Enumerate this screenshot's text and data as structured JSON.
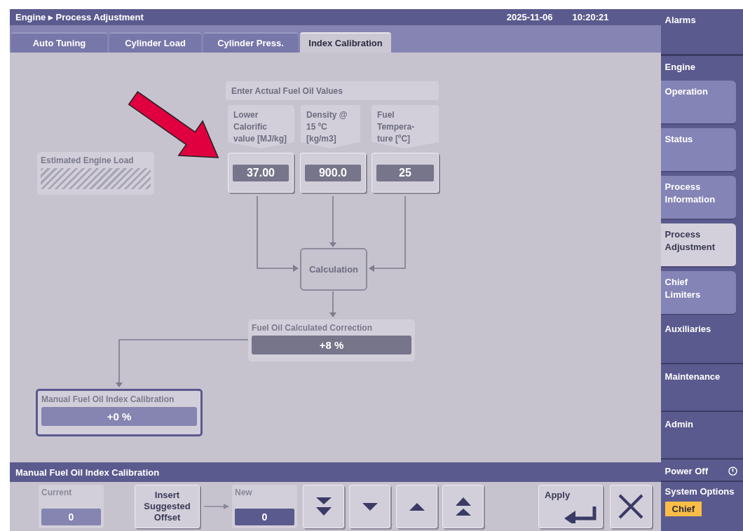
{
  "header": {
    "breadcrumb": "Engine ▸ Process Adjustment",
    "date": "2025-11-06",
    "time": "10:20:21"
  },
  "tabs": [
    {
      "label": "Auto Tuning",
      "selected": false
    },
    {
      "label": "Cylinder Load",
      "selected": false
    },
    {
      "label": "Cylinder Press.",
      "selected": false
    },
    {
      "label": "Index Calibration",
      "selected": true
    }
  ],
  "diagram": {
    "title": "Enter Actual Fuel Oil Values",
    "inputs": [
      {
        "label": "Lower Calorific\nvalue [MJ/kg]",
        "value": "37.00"
      },
      {
        "label": "Density @\n15 ºC [kg/m3]",
        "value": "900.0"
      },
      {
        "label": "Fuel Tempera-\nture [ºC]",
        "value": "25"
      }
    ],
    "estimated_load": {
      "label": "Estimated Engine Load"
    },
    "calculation": "Calculation",
    "correction": {
      "label": "Fuel Oil Calculated Correction",
      "value": "+8 %"
    },
    "manual": {
      "label": "Manual Fuel Oil Index Calibration",
      "value": "+0 %"
    }
  },
  "panel": {
    "title": "Manual Fuel Oil Index Calibration",
    "current": {
      "label": "Current",
      "value": "0"
    },
    "insert_button": "Insert\nSuggested\nOffset",
    "new": {
      "label": "New",
      "value": "0"
    },
    "steps": [
      {
        "kind": "fast-down"
      },
      {
        "kind": "down"
      },
      {
        "kind": "up"
      },
      {
        "kind": "fast-up"
      }
    ],
    "apply": "Apply"
  },
  "sidebar": {
    "alarms": "Alarms",
    "group": "Engine",
    "items": [
      {
        "label": "Operation",
        "kind": "sub",
        "selected": false
      },
      {
        "label": "Status",
        "kind": "sub",
        "selected": false
      },
      {
        "label": "Process\nInformation",
        "kind": "sub",
        "selected": false
      },
      {
        "label": "Process\nAdjustment",
        "kind": "sub",
        "selected": true
      },
      {
        "label": "Chief\nLimiters",
        "kind": "sub",
        "selected": false
      },
      {
        "label": "Auxiliaries",
        "kind": "section",
        "selected": false
      },
      {
        "label": "Maintenance",
        "kind": "section",
        "selected": false
      },
      {
        "label": "Admin",
        "kind": "section",
        "selected": false
      }
    ],
    "power_off": "Power Off",
    "system_options": {
      "label": "System Options",
      "role": "Chief"
    }
  }
}
